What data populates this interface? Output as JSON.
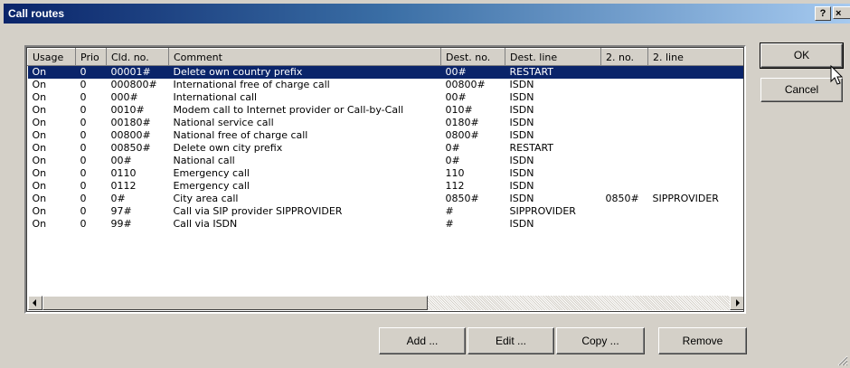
{
  "window": {
    "title": "Call routes",
    "help_label": "?",
    "close_label": "×"
  },
  "table": {
    "columns": [
      "Usage",
      "Prio",
      "Cld. no.",
      "Comment",
      "Dest. no.",
      "Dest. line",
      "2. no.",
      "2. line"
    ],
    "selected_row": 0,
    "rows": [
      [
        "On",
        "0",
        "00001#",
        "Delete own country prefix",
        "00#",
        "RESTART",
        "",
        ""
      ],
      [
        "On",
        "0",
        "000800#",
        "International free of charge call",
        "00800#",
        "ISDN",
        "",
        ""
      ],
      [
        "On",
        "0",
        "000#",
        "International call",
        "00#",
        "ISDN",
        "",
        ""
      ],
      [
        "On",
        "0",
        "0010#",
        "Modem call to Internet provider or Call-by-Call",
        "010#",
        "ISDN",
        "",
        ""
      ],
      [
        "On",
        "0",
        "00180#",
        "National service call",
        "0180#",
        "ISDN",
        "",
        ""
      ],
      [
        "On",
        "0",
        "00800#",
        "National free of charge call",
        "0800#",
        "ISDN",
        "",
        ""
      ],
      [
        "On",
        "0",
        "00850#",
        "Delete own city prefix",
        "0#",
        "RESTART",
        "",
        ""
      ],
      [
        "On",
        "0",
        "00#",
        "National call",
        "0#",
        "ISDN",
        "",
        ""
      ],
      [
        "On",
        "0",
        "0110",
        "Emergency call",
        "110",
        "ISDN",
        "",
        ""
      ],
      [
        "On",
        "0",
        "0112",
        "Emergency call",
        "112",
        "ISDN",
        "",
        ""
      ],
      [
        "On",
        "0",
        "0#",
        "City area call",
        "0850#",
        "ISDN",
        "0850#",
        "SIPPROVIDER"
      ],
      [
        "On",
        "0",
        "97#",
        "Call via SIP provider SIPPROVIDER",
        "#",
        "SIPPROVIDER",
        "",
        ""
      ],
      [
        "On",
        "0",
        "99#",
        "Call via ISDN",
        "#",
        "ISDN",
        "",
        ""
      ]
    ]
  },
  "buttons": {
    "ok": "OK",
    "cancel": "Cancel",
    "add": "Add ...",
    "edit": "Edit ...",
    "copy": "Copy ...",
    "remove": "Remove"
  },
  "colors": {
    "selection": "#0a246a",
    "title_gradient_start": "#0a246a",
    "title_gradient_end": "#a6caf0",
    "face": "#d4d0c8"
  }
}
